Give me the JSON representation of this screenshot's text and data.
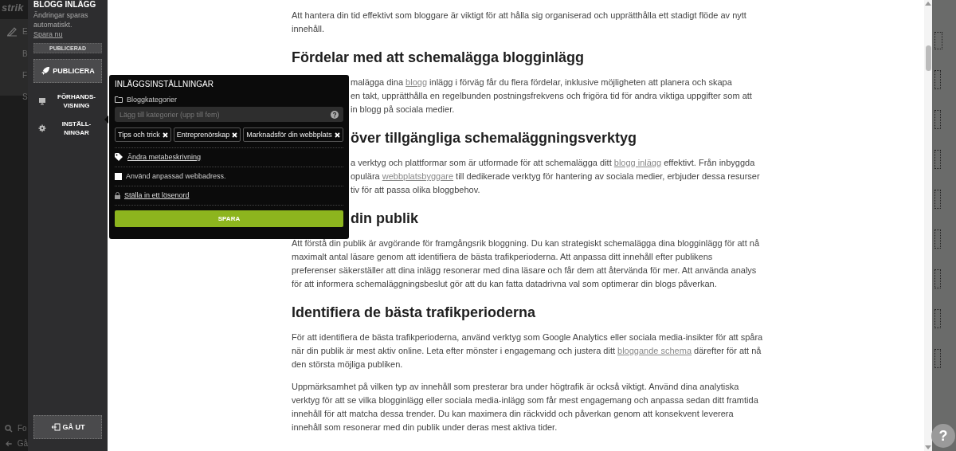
{
  "underlay": {
    "logo": "strik",
    "nav_fragments": [
      "E",
      "B",
      "F",
      "S"
    ],
    "bottom_fragments": [
      "Fo",
      "Gå"
    ]
  },
  "sidebar": {
    "title": "BLOGG INLÄGG",
    "subtitle": "Ändringar sparas automatiskt.",
    "save_link": "Spara nu",
    "status": "PUBLICERAD",
    "publish": "PUBLICERA",
    "items": [
      {
        "label": "FÖRHANDS-VISNING",
        "kind": "preview"
      },
      {
        "label": "INSTÄLL-NINGAR",
        "kind": "settings"
      }
    ],
    "exit": "GÅ UT"
  },
  "article": [
    {
      "kind": "p",
      "lines": [
        [
          {
            "text": "Att hantera din tid effektivt som bloggare är viktigt för att hålla sig organiserad och upprätthålla ett stadigt flöde av nytt"
          }
        ],
        [
          {
            "text": "innehåll."
          }
        ]
      ]
    },
    {
      "kind": "h",
      "text": "Fördelar med att schemalägga blogginlägg"
    },
    {
      "kind": "p_cut",
      "lines": [
        [
          {
            "text": "malägga dina "
          },
          {
            "text": "blogg",
            "kind": "link"
          },
          {
            "text": " inlägg i förväg får du flera fördelar, inklusive möjligheten att planera och skapa"
          }
        ],
        [
          {
            "text": "en takt, upprätthålla en regelbunden postningsfrekvens och frigöra tid för andra viktiga uppgifter som att"
          }
        ],
        [
          {
            "text": "in blogg på sociala medier."
          }
        ]
      ]
    },
    {
      "kind": "h_cut",
      "text": "över tillgängliga schemaläggningsverktyg"
    },
    {
      "kind": "p_cut",
      "lines": [
        [
          {
            "text": "a verktyg och plattformar som är utformade för att schemalägga ditt "
          },
          {
            "text": "blogg inlägg",
            "kind": "link"
          },
          {
            "text": " effektivt. Från inbyggda"
          }
        ],
        [
          {
            "text": "opulära "
          },
          {
            "text": "webbplatsbyggare",
            "kind": "link"
          },
          {
            "text": " till dedikerade verktyg för hantering av sociala medier, erbjuder dessa resurser"
          }
        ],
        [
          {
            "text": "tiv för att passa olika bloggbehov."
          }
        ]
      ]
    },
    {
      "kind": "h_cut",
      "text": "din publik"
    },
    {
      "kind": "p",
      "lines": [
        [
          {
            "text": "Att förstå din publik är avgörande för framgångsrik bloggning. Du kan strategiskt schemalägga dina blogginlägg för att nå"
          }
        ],
        [
          {
            "text": "maximalt antal läsare genom att identifiera de bästa trafikperioderna. Att anpassa ditt innehåll efter publikens"
          }
        ],
        [
          {
            "text": "preferenser säkerställer att dina inlägg resonerar med dina läsare och får dem att återvända för mer. Att använda analys"
          }
        ],
        [
          {
            "text": "för att informera schemaläggningsbeslut gör att du kan fatta datadrivna val som optimerar din blogs påverkan."
          }
        ]
      ]
    },
    {
      "kind": "h",
      "text": "Identifiera de bästa trafikperioderna"
    },
    {
      "kind": "p",
      "lines": [
        [
          {
            "text": "För att identifiera de bästa trafikperioderna, använd verktyg som Google Analytics eller sociala media-insikter för att spåra"
          }
        ],
        [
          {
            "text": "när din publik är mest aktiv online. Leta efter mönster i engagemang och justera ditt "
          },
          {
            "text": "bloggande schema",
            "kind": "link"
          },
          {
            "text": " därefter för att nå"
          }
        ],
        [
          {
            "text": "den största möjliga publiken."
          }
        ]
      ]
    },
    {
      "kind": "p",
      "lines": [
        [
          {
            "text": "Uppmärksamhet på vilken typ av innehåll som presterar bra under högtrafik är också viktigt. Använd dina analytiska"
          }
        ],
        [
          {
            "text": "verktyg för att se vilka blogginlägg eller sociala media-inlägg som får mest engagemang och anpassa sedan ditt framtida"
          }
        ],
        [
          {
            "text": "innehåll för att matcha dessa trender. Du kan maximera din räckvidd och påverkan genom att konsekvent leverera"
          }
        ],
        [
          {
            "text": "innehåll som resonerar med din publik under deras mest aktiva tider."
          }
        ]
      ]
    }
  ],
  "popup": {
    "title": "INLÄGGSINSTÄLLNINGAR",
    "categories_label": "Bloggkategorier",
    "category_input": {
      "placeholder": "Lägg till kategorier (upp till fem)"
    },
    "tags": [
      "Tips och trick",
      "Entreprenörskap",
      "Marknadsför din webbplats"
    ],
    "meta_link": "Ändra metabeskrivning",
    "custom_url": {
      "label": "Använd anpassad webbadress.",
      "checked": false
    },
    "password_link": "Ställa in ett lösenord",
    "save": "SPARA"
  },
  "help": "?"
}
